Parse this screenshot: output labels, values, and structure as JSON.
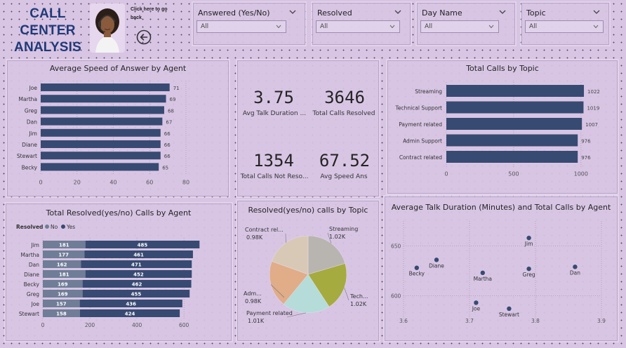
{
  "header": {
    "title_line1": "CALL CENTER",
    "title_line2": "ANALYSIS",
    "back_note": "Click here to go back",
    "back_icon": "arrow-left-circle-icon",
    "avatar_icon": "agent-headset-photo"
  },
  "slicers": [
    {
      "label": "Answered (Yes/No)",
      "value": "All"
    },
    {
      "label": "Resolved",
      "value": "All"
    },
    {
      "label": "Day Name",
      "value": "All"
    },
    {
      "label": "Topic",
      "value": "All"
    }
  ],
  "kpis": [
    {
      "value": "3.75",
      "label": "Avg Talk Duration ..."
    },
    {
      "value": "3646",
      "label": "Total Calls Resolved"
    },
    {
      "value": "1354",
      "label": "Total Calls Not Reso..."
    },
    {
      "value": "67.52",
      "label": "Avg Speed Ans"
    }
  ],
  "colors": {
    "bar": "#374a72",
    "bar_light": "#6f7d96",
    "accent_title": "#1f3a78",
    "pie": [
      "#b8b4b0",
      "#a5ab3e",
      "#b5dcd8",
      "#e0ad88",
      "#d8c9b6"
    ]
  },
  "chart_data": [
    {
      "type": "bar",
      "title": "Average Speed of Answer by Agent",
      "orientation": "horizontal",
      "categories": [
        "Joe",
        "Martha",
        "Greg",
        "Dan",
        "Jim",
        "Diane",
        "Stewart",
        "Becky"
      ],
      "values": [
        71,
        69,
        68,
        67,
        66,
        66,
        66,
        65
      ],
      "xlim": [
        0,
        80
      ],
      "xticks": [
        "0",
        "20",
        "40",
        "60",
        "80"
      ],
      "data_labels": [
        "71",
        "69",
        "68",
        "67",
        "66",
        "66",
        "66",
        "65"
      ]
    },
    {
      "type": "bar",
      "title": "Total Calls by Topic",
      "orientation": "horizontal",
      "categories": [
        "Streaming",
        "Technical Support",
        "Payment related",
        "Admin Support",
        "Contract related"
      ],
      "values": [
        1022,
        1019,
        1007,
        976,
        976
      ],
      "xlim": [
        0,
        1100
      ],
      "xticks": [
        "0",
        "500",
        "1000"
      ],
      "data_labels": [
        "1022",
        "1019",
        "1007",
        "976",
        "976"
      ]
    },
    {
      "type": "bar",
      "title": "Total Resolved(yes/no) Calls by Agent",
      "orientation": "horizontal",
      "stacked": true,
      "legend_title": "Resolved",
      "categories": [
        "Jim",
        "Martha",
        "Dan",
        "Diane",
        "Becky",
        "Greg",
        "Joe",
        "Stewart"
      ],
      "series": [
        {
          "name": "No",
          "values": [
            181,
            177,
            162,
            181,
            169,
            169,
            157,
            158
          ]
        },
        {
          "name": "Yes",
          "values": [
            485,
            461,
            471,
            452,
            462,
            455,
            436,
            424
          ]
        }
      ],
      "xlim": [
        0,
        680
      ],
      "xticks": [
        "0",
        "200",
        "400",
        "600"
      ]
    },
    {
      "type": "pie",
      "title": "Resolved(yes/no) calls by Topic",
      "categories": [
        "Streaming",
        "Technical Support",
        "Payment related",
        "Admin Support",
        "Contract related"
      ],
      "values": [
        1022,
        1019,
        1007,
        976,
        976
      ],
      "slice_labels": [
        {
          "name": "Streaming",
          "value": "1.02K"
        },
        {
          "name": "Tech...",
          "value": "1.02K"
        },
        {
          "name": "Payment related",
          "value": "1.01K"
        },
        {
          "name": "Adm...",
          "value": "0.98K"
        },
        {
          "name": "Contract rel...",
          "value": "0.98K"
        }
      ]
    },
    {
      "type": "scatter",
      "title": "Average Talk Duration (Minutes) and Total Calls by Agent",
      "x": [
        3.79,
        3.72,
        3.65,
        3.62,
        3.79,
        3.86,
        3.71,
        3.76
      ],
      "y": [
        658,
        623,
        636,
        628,
        627,
        629,
        593,
        587
      ],
      "point_labels": [
        "Jim",
        "Martha",
        "Diane",
        "Becky",
        "Greg",
        "Dan",
        "Joe",
        "Stewart"
      ],
      "xlim": [
        3.6,
        3.9
      ],
      "ylim": [
        575,
        675
      ],
      "xticks": [
        "3.6",
        "3.7",
        "3.8",
        "3.9"
      ],
      "yticks": [
        "600",
        "650"
      ]
    }
  ]
}
